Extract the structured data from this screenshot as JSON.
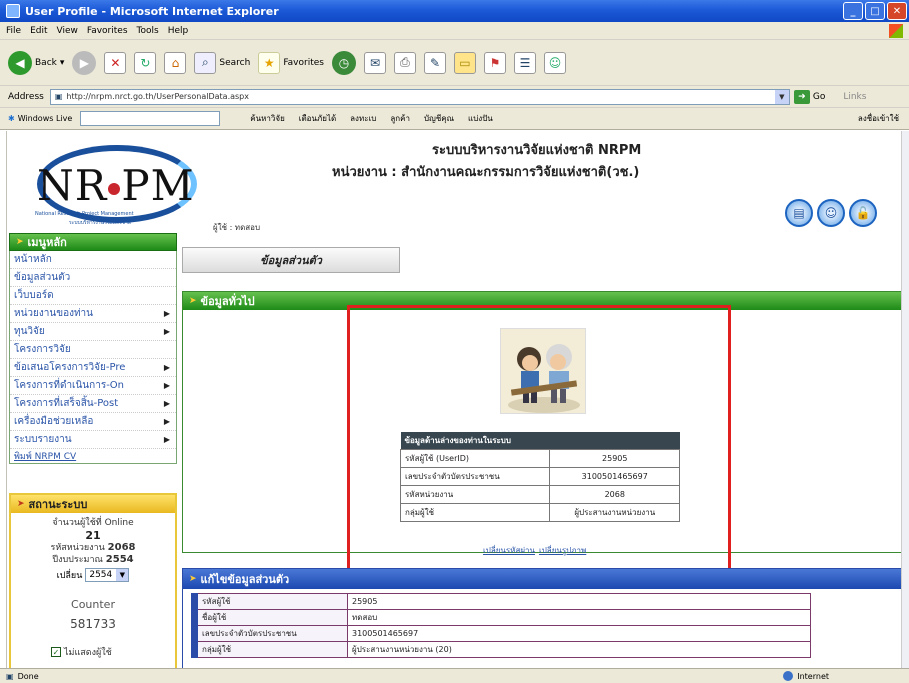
{
  "window": {
    "title": "User Profile - Microsoft Internet Explorer",
    "buttons": [
      "_",
      "□",
      "✕"
    ]
  },
  "menubar": [
    "File",
    "Edit",
    "View",
    "Favorites",
    "Tools",
    "Help"
  ],
  "toolbar": {
    "back": "Back",
    "search": "Search",
    "favorites": "Favorites"
  },
  "address": {
    "label": "Address",
    "url": "http://nrpm.nrct.go.th/UserPersonalData.aspx",
    "go": "Go",
    "links": "Links"
  },
  "linksbar": {
    "windows_live": "Windows Live",
    "links": [
      "ค้นหาวิจัย",
      "เตือนภัยได้",
      "ลงทะเบ",
      "ลูกค้า",
      "บัญชีคุณ",
      "แบ่งปัน"
    ],
    "right": "ลงชื่อเข้าใช้"
  },
  "header": {
    "logo_text": "NR",
    "logo_text2": "PM",
    "logo_sub": "National Research Project Management",
    "logo_sub2": "ระบบบริหารงานวิจัยแห่งชาติ",
    "greeting": "ผู้ใช้ : ทดสอบ",
    "system_title": "ระบบบริหารงานวิจัยแห่งชาติ NRPM",
    "agency": "หน่วยงาน : สำนักงานคณะกรรมการวิจัยแห่งชาติ(วช.)"
  },
  "leftmenu": {
    "title": "เมนูหลัก",
    "items": [
      {
        "label": "หน้าหลัก",
        "more": false
      },
      {
        "label": "ข้อมูลส่วนตัว",
        "more": false
      },
      {
        "label": "เว็บบอร์ด",
        "more": false
      },
      {
        "label": "หน่วยงานของท่าน",
        "more": true
      },
      {
        "label": "ทุนวิจัย",
        "more": true
      },
      {
        "label": "โครงการวิจัย",
        "more": false
      },
      {
        "label": "ข้อเสนอโครงการวิจัย-Pre",
        "more": true
      },
      {
        "label": "โครงการที่ดำเนินการ-On",
        "more": true
      },
      {
        "label": "โครงการที่เสร็จสิ้น-Post",
        "more": true
      },
      {
        "label": "เครื่องมือช่วยเหลือ",
        "more": true
      },
      {
        "label": "ระบบรายงาน",
        "more": true
      }
    ],
    "cv_link": "พิมพ์ NRPM CV"
  },
  "status": {
    "title": "สถานะระบบ",
    "online_label": "จำนวนผู้ใช้ที่ Online",
    "online_count": "21",
    "agency_code_label": "รหัสหน่วยงาน",
    "agency_code": "2068",
    "budget_year_label": "ปีงบประมาณ",
    "budget_year": "2554",
    "select_label": "เปลี่ยน",
    "select_value": "2554",
    "counter_label": "Counter",
    "counter_value": "581733",
    "remember_label": "ไม่แสดงผู้ใช้"
  },
  "personal_button": "ข้อมูลส่วนตัว",
  "general": {
    "title": "ข้อมูลทั่วไป",
    "table_title": "ข้อมูลด้านล่างของท่านในระบบ",
    "rows": [
      {
        "label": "รหัสผู้ใช้ (UserID)",
        "value": "25905"
      },
      {
        "label": "เลขประจำตัวบัตรประชาชน",
        "value": "3100501465697"
      },
      {
        "label": "รหัสหน่วยงาน",
        "value": "2068"
      },
      {
        "label": "กลุ่มผู้ใช้",
        "value": "ผู้ประสานงานหน่วยงาน"
      }
    ],
    "link1": "เปลี่ยนรหัสผ่าน",
    "link2": "เปลี่ยนรูปภาพ"
  },
  "edit": {
    "title": "แก้ไขข้อมูลส่วนตัว",
    "rows": [
      {
        "label": "รหัสผู้ใช้",
        "value": "25905"
      },
      {
        "label": "ชื่อผู้ใช้",
        "value": "ทดสอบ"
      },
      {
        "label": "เลขประจำตัวบัตรประชาชน",
        "value": "3100501465697"
      },
      {
        "label": "กลุ่มผู้ใช้",
        "value": "ผู้ประสานงานหน่วยงาน (20)"
      }
    ]
  },
  "statusbar": {
    "left": "Done",
    "zone": "Internet"
  },
  "colors": {
    "highlight": "#e0201e",
    "green_header": "#1e8a17",
    "blue_header": "#1c48b0"
  }
}
